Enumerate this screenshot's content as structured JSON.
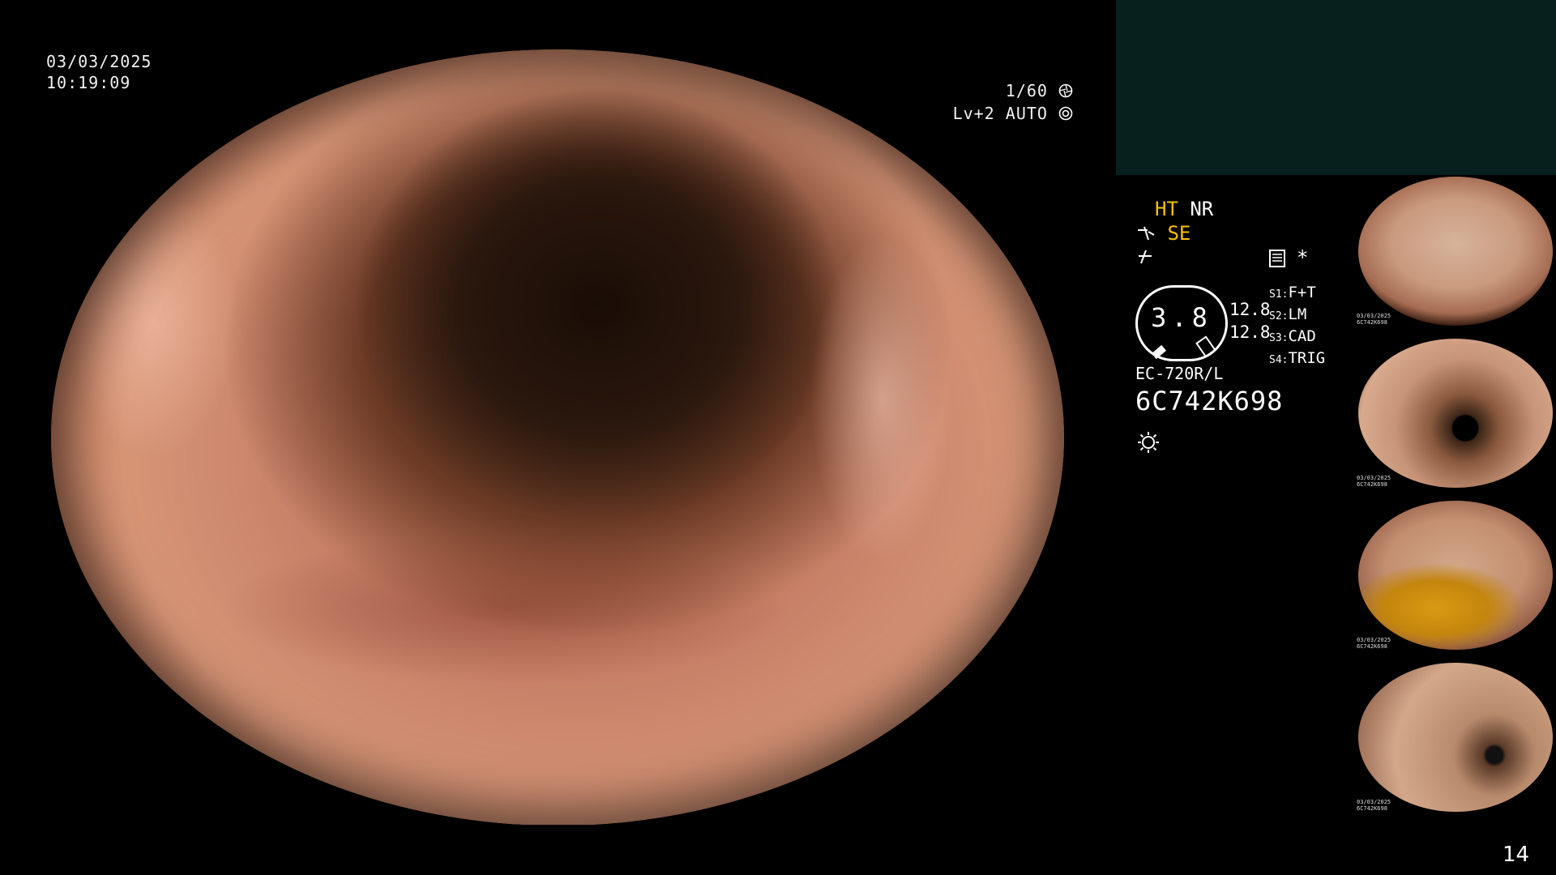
{
  "overlay": {
    "date": "03/03/2025",
    "time": "10:19:09",
    "shutter": "1/60",
    "level": "Lv+2",
    "mode": "AUTO"
  },
  "panel": {
    "ht_label": "HT",
    "nr_label": "NR",
    "se_label": "SE",
    "gauge_value": "3.8",
    "reading_top": "12.8",
    "reading_bottom": "12.8",
    "scope_model": "EC-720R/L",
    "serial": "6C742K698",
    "switches": [
      {
        "key": "S1:",
        "value": "F+T"
      },
      {
        "key": "S2:",
        "value": "LM"
      },
      {
        "key": "S3:",
        "value": "CAD"
      },
      {
        "key": "S4:",
        "value": "TRIG"
      }
    ],
    "asterisk": "*"
  },
  "thumbnails": [
    {
      "caption": "03/03/2025\n6C742K698"
    },
    {
      "caption": "03/03/2025\n6C742K698"
    },
    {
      "caption": "03/03/2025\n6C742K698"
    },
    {
      "caption": "03/03/2025\n6C742K698"
    }
  ],
  "page_number": "14",
  "colors": {
    "accent_yellow": "#f5c000",
    "panel_teal": "#07201e"
  }
}
